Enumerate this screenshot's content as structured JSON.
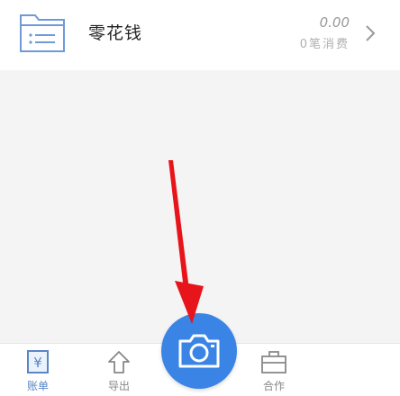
{
  "category": {
    "name": "零花钱",
    "amount": "0.00",
    "count_text": "0笔消费",
    "icon": "folder-list-icon"
  },
  "tabbar": {
    "bills_label": "账单",
    "export_label": "导出",
    "book_label": "合作",
    "camera_icon": "camera-icon"
  },
  "colors": {
    "accent": "#3a84e6",
    "arrow": "#e8141b"
  }
}
